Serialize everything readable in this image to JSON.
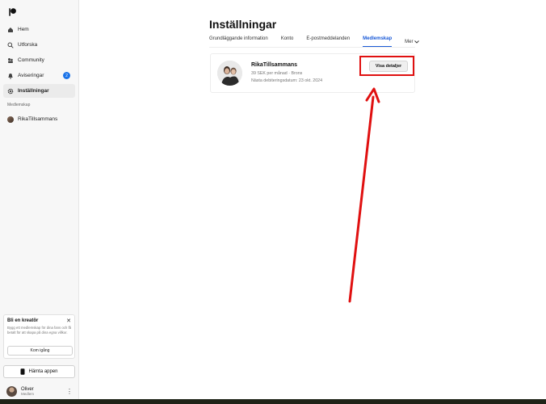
{
  "sidebar": {
    "items": [
      {
        "label": "Hem",
        "icon": "home-icon"
      },
      {
        "label": "Utforska",
        "icon": "search-icon"
      },
      {
        "label": "Community",
        "icon": "community-icon"
      },
      {
        "label": "Aviseringar",
        "icon": "bell-icon",
        "badge": "2"
      },
      {
        "label": "Inställningar",
        "icon": "gear-icon",
        "active": true
      }
    ],
    "section_label": "Medlemskap",
    "membership_item": "RikaTillsammans",
    "creator_card": {
      "title": "Bli en kreatör",
      "description": "Bygg ett medlemskap för dina fans och få betalt för att skapa på dina egna villkor.",
      "button": "Kom igång"
    },
    "app_button": "Hämta appen",
    "user": {
      "name": "Oliver",
      "role": "Medlem"
    }
  },
  "main": {
    "title": "Inställningar",
    "tabs": [
      {
        "label": "Grundläggande information"
      },
      {
        "label": "Konto"
      },
      {
        "label": "E-postmeddelanden"
      },
      {
        "label": "Medlemskap",
        "active": true
      },
      {
        "label": "Mer"
      }
    ],
    "membership": {
      "name": "RikaTillsammans",
      "price": "39 SEK per månad · Brons",
      "next_billing": "Nästa debiteringsdatum: 23 okt. 2024",
      "details_button": "Visa detaljer"
    }
  },
  "colors": {
    "accent": "#1a5ad7",
    "badge": "#1a73e8",
    "annotation": "#e01010"
  }
}
